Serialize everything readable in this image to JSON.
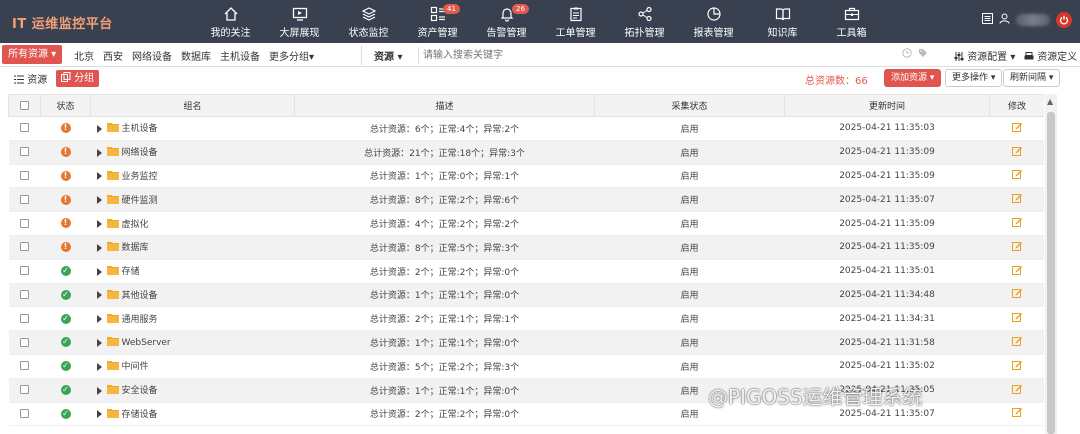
{
  "app": {
    "title": "IT 运维监控平台",
    "nav": [
      {
        "label": "我的关注",
        "icon": "home-icon",
        "badge": null
      },
      {
        "label": "大屏展现",
        "icon": "screen-icon",
        "badge": null
      },
      {
        "label": "状态监控",
        "icon": "layers-icon",
        "badge": null
      },
      {
        "label": "资产管理",
        "icon": "grid-icon",
        "badge": "41"
      },
      {
        "label": "告警管理",
        "icon": "bell-icon",
        "badge": "26"
      },
      {
        "label": "工单管理",
        "icon": "clipboard-icon",
        "badge": null
      },
      {
        "label": "拓扑管理",
        "icon": "topology-icon",
        "badge": null
      },
      {
        "label": "报表管理",
        "icon": "pie-chart-icon",
        "badge": null
      },
      {
        "label": "知识库",
        "icon": "book-icon",
        "badge": null
      },
      {
        "label": "工具箱",
        "icon": "toolbox-icon",
        "badge": null
      }
    ]
  },
  "filterbar": {
    "all_label": "所有资源 ▾",
    "filters": [
      "北京",
      "西安",
      "网络设备",
      "数据库",
      "主机设备",
      "更多分组▾"
    ],
    "search_type": "资源",
    "search_placeholder": "请输入搜索关键字",
    "config_label": "资源配置 ▾",
    "define_label": "资源定义"
  },
  "toolbar": {
    "resource_label": "资源",
    "group_label": "分组",
    "total_label": "总资源数：66",
    "add_label": "添加资源 ▾",
    "more_label": "更多操作 ▾",
    "refresh_label": "刷新间隔 ▾"
  },
  "table": {
    "headers": [
      "",
      "状态",
      "组名",
      "描述",
      "采集状态",
      "更新时间",
      "修改"
    ],
    "rows": [
      {
        "status": "warning",
        "name": "主机设备",
        "desc": "总计资源：6个；正常:4个；异常:2个",
        "collect": "启用",
        "time": "2025-04-21 11:35:03"
      },
      {
        "status": "warning",
        "name": "网络设备",
        "desc": "总计资源：21个；正常:18个；异常:3个",
        "collect": "启用",
        "time": "2025-04-21 11:35:09"
      },
      {
        "status": "warning",
        "name": "业务监控",
        "desc": "总计资源：1个；正常:0个；异常:1个",
        "collect": "启用",
        "time": "2025-04-21 11:35:09"
      },
      {
        "status": "warning",
        "name": "硬件监测",
        "desc": "总计资源：8个；正常:2个；异常:6个",
        "collect": "启用",
        "time": "2025-04-21 11:35:07"
      },
      {
        "status": "warning",
        "name": "虚拟化",
        "desc": "总计资源：4个；正常:2个；异常:2个",
        "collect": "启用",
        "time": "2025-04-21 11:35:09"
      },
      {
        "status": "warning",
        "name": "数据库",
        "desc": "总计资源：8个；正常:5个；异常:3个",
        "collect": "启用",
        "time": "2025-04-21 11:35:09"
      },
      {
        "status": "ok",
        "name": "存储",
        "desc": "总计资源：2个；正常:2个；异常:0个",
        "collect": "启用",
        "time": "2025-04-21 11:35:01"
      },
      {
        "status": "ok",
        "name": "其他设备",
        "desc": "总计资源：1个；正常:1个；异常:0个",
        "collect": "启用",
        "time": "2025-04-21 11:34:48"
      },
      {
        "status": "ok",
        "name": "通用服务",
        "desc": "总计资源：2个；正常:1个；异常:1个",
        "collect": "启用",
        "time": "2025-04-21 11:34:31"
      },
      {
        "status": "ok",
        "name": "WebServer",
        "desc": "总计资源：1个；正常:1个；异常:0个",
        "collect": "启用",
        "time": "2025-04-21 11:31:58"
      },
      {
        "status": "ok",
        "name": "中间件",
        "desc": "总计资源：5个；正常:2个；异常:3个",
        "collect": "启用",
        "time": "2025-04-21 11:35:02"
      },
      {
        "status": "ok",
        "name": "安全设备",
        "desc": "总计资源：1个；正常:1个；异常:0个",
        "collect": "启用",
        "time": "2025-04-21 11:35:05"
      },
      {
        "status": "ok",
        "name": "存储设备",
        "desc": "总计资源：2个；正常:2个；异常:0个",
        "collect": "启用",
        "time": "2025-04-21 11:35:07"
      }
    ]
  },
  "watermark": "@PIGOSS运维管理系统",
  "colors": {
    "nav_bg": "#39404f",
    "accent_red": "#e0554f",
    "warning": "#e8762c",
    "ok": "#3aa655",
    "folder": "#f5a623"
  }
}
